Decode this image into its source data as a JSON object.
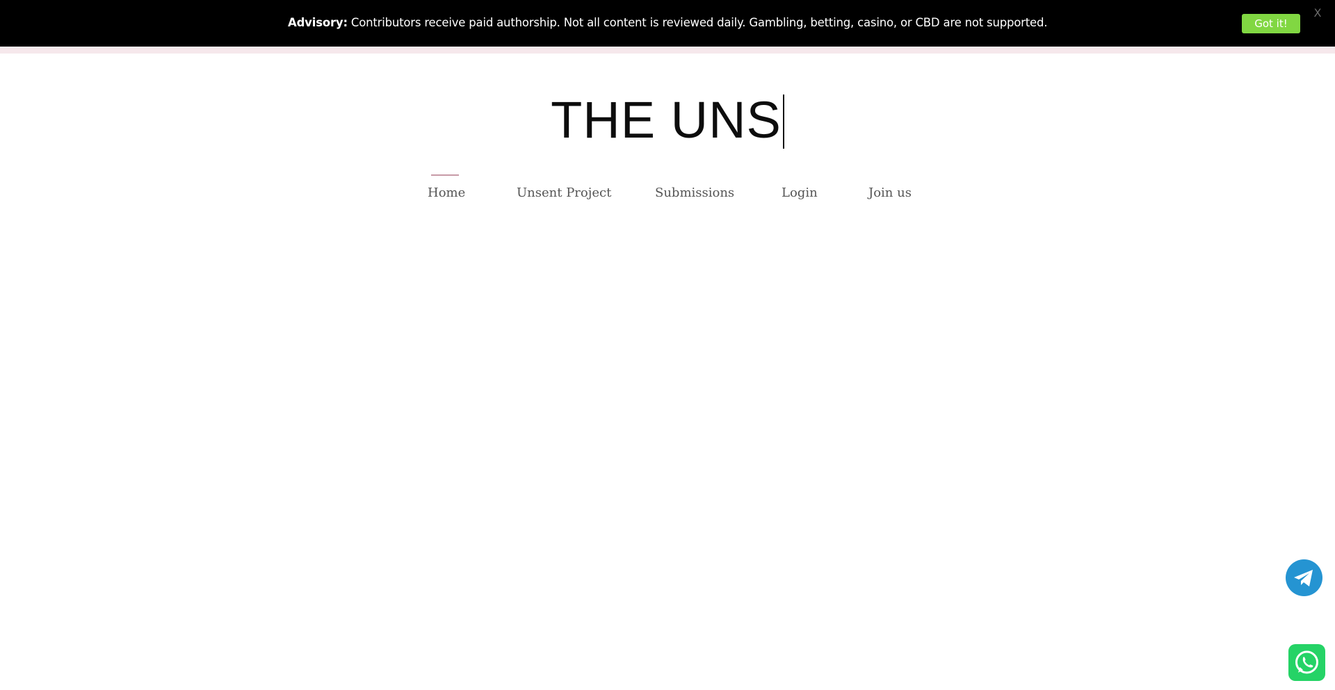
{
  "advisory": {
    "label": "Advisory:",
    "message": "Contributors receive paid authorship. Not all content is reviewed daily. Gambling, betting, casino, or CBD are not supported.",
    "button_label": "Got it!",
    "close_label": "X"
  },
  "site": {
    "title": "THE UNS"
  },
  "nav": {
    "items": [
      {
        "label": "Home",
        "active": true
      },
      {
        "label": "Unsent Project",
        "active": false
      },
      {
        "label": "Submissions",
        "active": false
      },
      {
        "label": "Login",
        "active": false
      },
      {
        "label": "Join us",
        "active": false
      }
    ]
  },
  "floating": {
    "telegram_icon": "telegram-icon",
    "whatsapp_icon": "whatsapp-icon"
  },
  "colors": {
    "advisory_bg": "#000000",
    "got_it_bg": "#81d742",
    "accent_pink": "#c79aa6",
    "telegram": "#2594d2",
    "whatsapp": "#25d366"
  }
}
